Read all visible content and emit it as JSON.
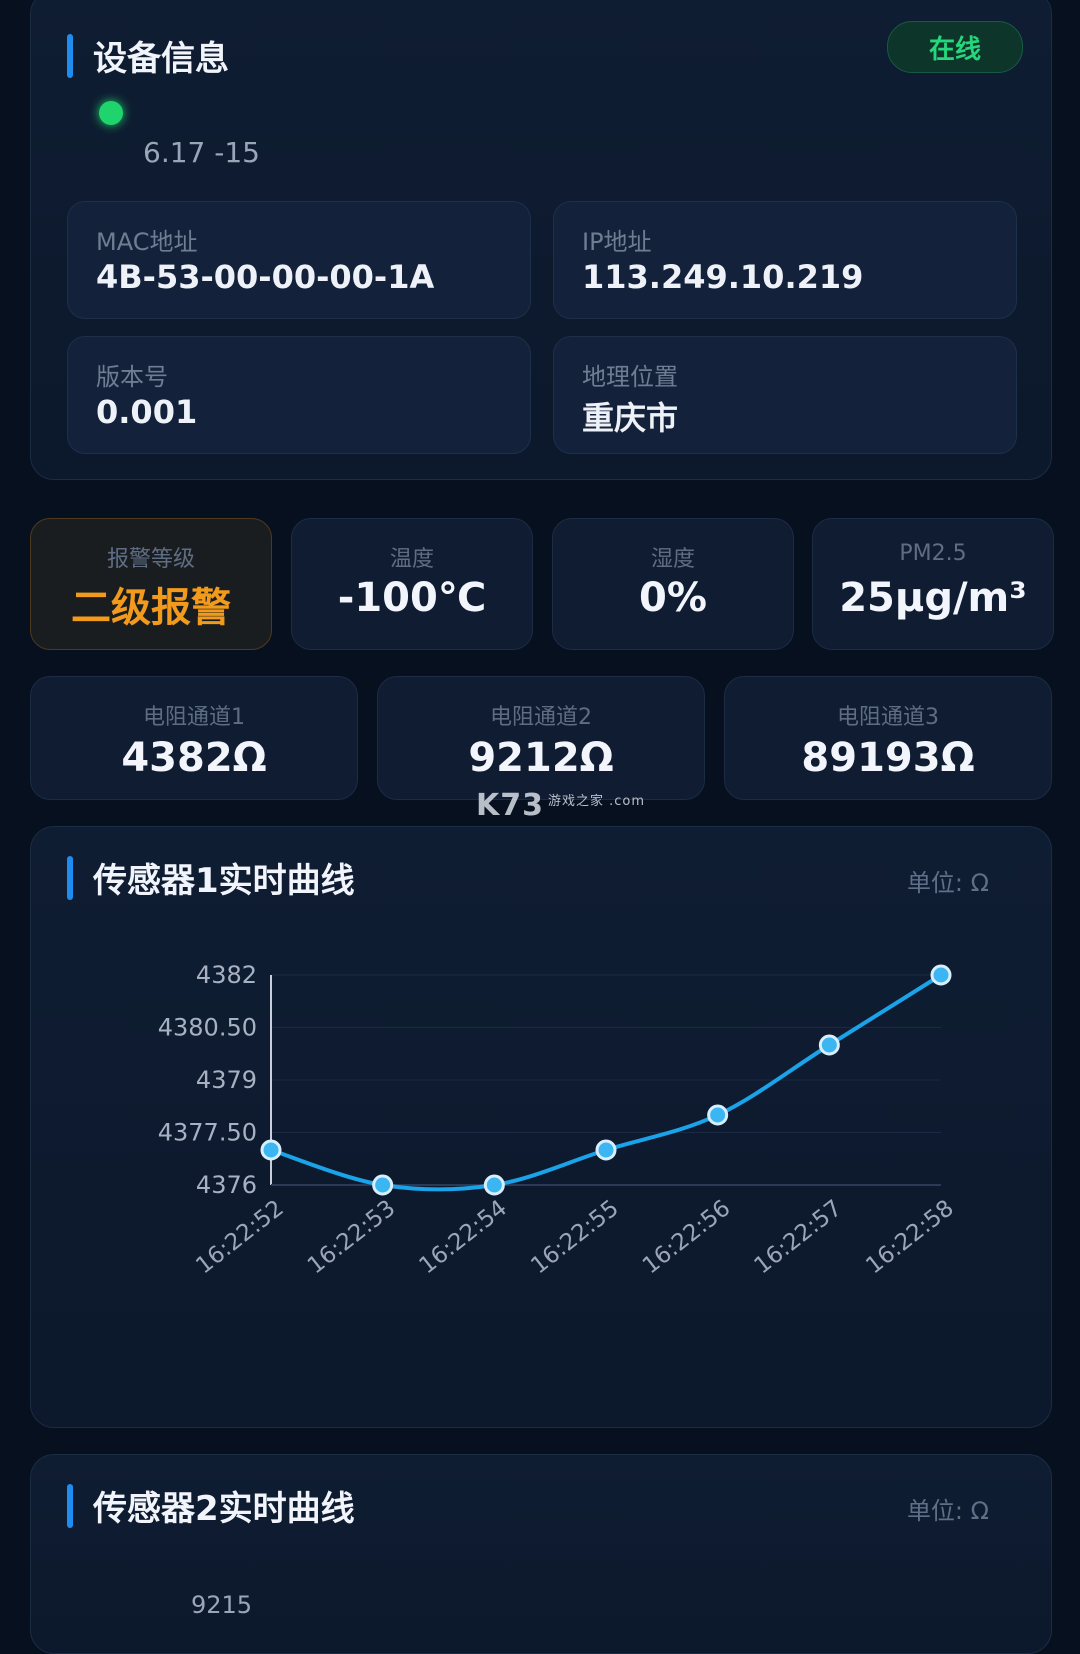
{
  "device_info": {
    "title": "设备信息",
    "status": "在线",
    "subtitle": "6.17 -15",
    "fields": [
      {
        "label": "MAC地址",
        "value": "4B-53-00-00-00-1A"
      },
      {
        "label": "IP地址",
        "value": "113.249.10.219"
      },
      {
        "label": "版本号",
        "value": "0.001"
      },
      {
        "label": "地理位置",
        "value": "重庆市"
      }
    ]
  },
  "metrics": [
    {
      "label": "报警等级",
      "value": "二级报警"
    },
    {
      "label": "温度",
      "value": "-100℃"
    },
    {
      "label": "湿度",
      "value": "0%"
    },
    {
      "label": "PM2.5",
      "value": "25μg/m³"
    }
  ],
  "resistances": [
    {
      "label": "电阻通道1",
      "value": "4382Ω"
    },
    {
      "label": "电阻通道2",
      "value": "9212Ω"
    },
    {
      "label": "电阻通道3",
      "value": "89193Ω"
    }
  ],
  "watermark": {
    "brand": "K73",
    "sub": "游戏之家 .com"
  },
  "sensor1": {
    "title": "传感器1实时曲线",
    "unit": "单位: Ω"
  },
  "sensor2": {
    "title": "传感器2实时曲线",
    "unit": "单位: Ω",
    "first_tick": "9215"
  },
  "colors": {
    "accent": "#1f8cf0",
    "online": "#25d67c",
    "alarm": "#f19a1c",
    "line": "#1aa3e8"
  },
  "chart_data": {
    "type": "line",
    "x": [
      "16:22:52",
      "16:22:53",
      "16:22:54",
      "16:22:55",
      "16:22:56",
      "16:22:57",
      "16:22:58"
    ],
    "values": [
      4377,
      4376,
      4376,
      4377,
      4378,
      4380,
      4382
    ],
    "yticks": [
      "4376",
      "4377.50",
      "4379",
      "4380.50",
      "4382"
    ],
    "ylim": [
      4376,
      4382
    ],
    "grid": true
  }
}
